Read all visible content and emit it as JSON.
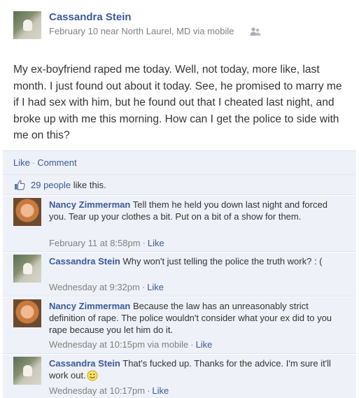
{
  "post": {
    "author": "Cassandra Stein",
    "meta": "February 10 near North Laurel, MD via mobile",
    "audience_icon": "friends-icon",
    "text": "My ex-boyfriend raped me today. Well, not today, more like, last month. I just found out about it today. See, he promised to marry me if I had sex with him, but he found out that I cheated last night, and broke up with me this morning. How can I get the police to side with me on this?"
  },
  "actions": {
    "like": "Like",
    "separator": "·",
    "comment": "Comment"
  },
  "likes": {
    "count": "29 people",
    "suffix": "like this."
  },
  "comments": [
    {
      "author": "Nancy Zimmerman",
      "text": "Tell them he held you down last night and forced you. Tear up your clothes a bit. Put on a bit of a show for them.",
      "time": "February 11 at 8:58pm",
      "like": "Like"
    },
    {
      "author": "Cassandra Stein",
      "text": "Why won't just telling the police the truth work? : (",
      "time": "Wednesday at 9:32pm",
      "like": "Like"
    },
    {
      "author": "Nancy Zimmerman",
      "text": "Because the law has an unreasonably strict definition of rape. The police wouldn't consider what your ex did to you rape because you let him do it.",
      "time": "Wednesday at 10:15pm via mobile",
      "like": "Like"
    },
    {
      "author": "Cassandra Stein",
      "text": "That's fucked up. Thanks for the advice. I'm sure it'll work out.",
      "time": "Wednesday at 10:17pm",
      "like": "Like",
      "emoticon": "smiley-icon"
    }
  ],
  "colors": {
    "link": "#3b5998",
    "meta": "#808080",
    "comment_bg": "#eef1f7"
  }
}
